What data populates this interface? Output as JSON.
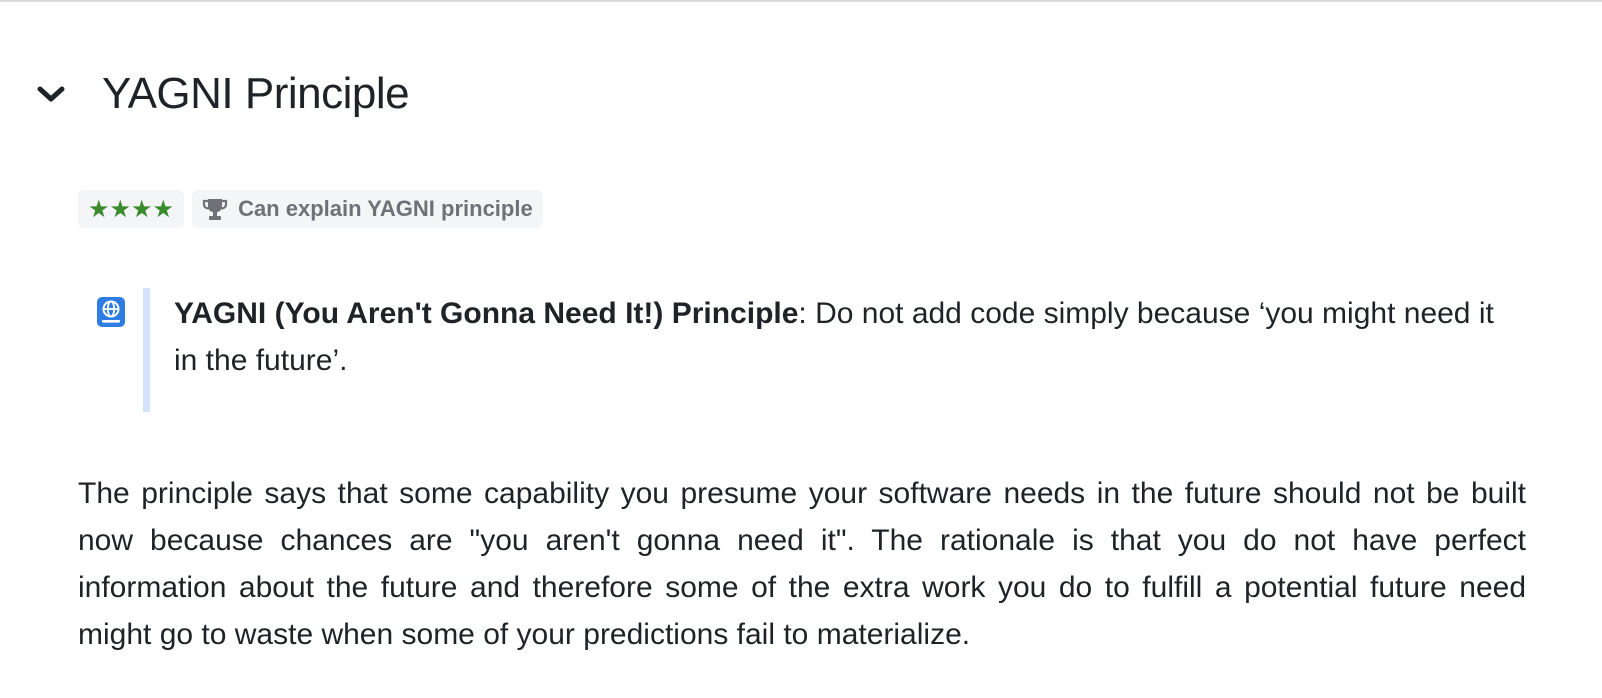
{
  "section": {
    "title": "YAGNI Principle",
    "chevron_icon": "chevron-down-icon"
  },
  "badges": {
    "stars": "★★★★",
    "star_color": "#3a8a2e",
    "outcome_icon": "trophy-icon",
    "outcome_label": "Can explain YAGNI principle"
  },
  "definition": {
    "icon": "globe-book-icon",
    "icon_color": "#2f7de1",
    "bar_color": "#d4e3fb",
    "term": "YAGNI (You Aren't Gonna Need It!) Principle",
    "text": ": Do not add code simply because ‘you might need it in the future’."
  },
  "paragraph": {
    "text": "The principle says that some capability you presume your software needs in the future should not be built now because chances are \"you aren't gonna need it\". The rationale is that you do not have perfect information about the future and therefore some of the extra work you do to fulfill a potential future need might go to waste when some of your predictions fail to materialize."
  }
}
